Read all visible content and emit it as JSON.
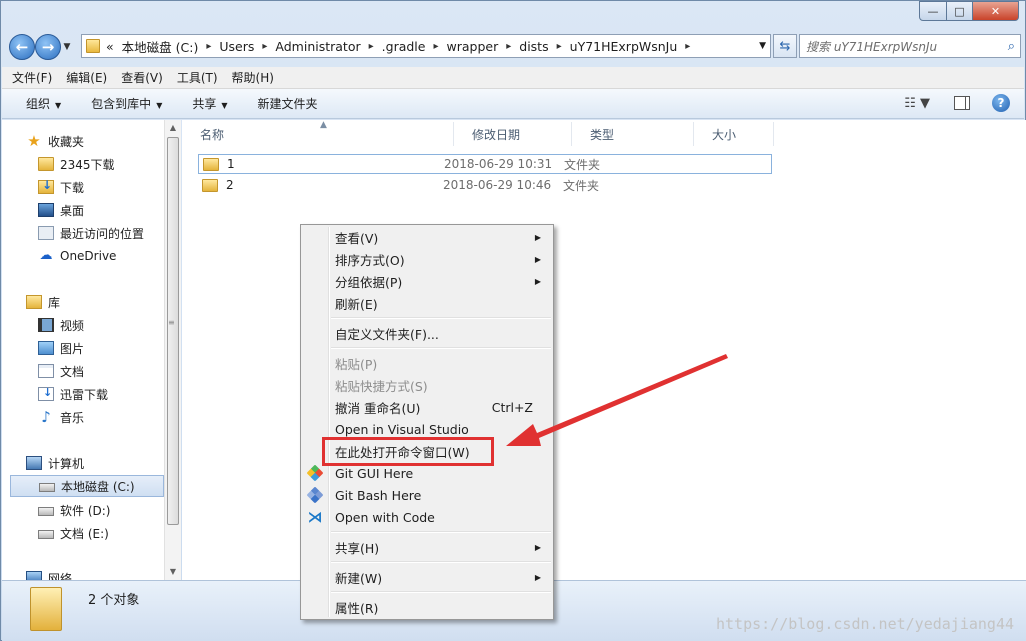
{
  "window": {
    "caption_buttons": {
      "minimize": "—",
      "maximize": "□",
      "close": "✕"
    }
  },
  "nav": {
    "back_icon": "arrow-left-icon",
    "forward_icon": "arrow-right-icon",
    "breadcrumb_prefix": "«",
    "breadcrumb": [
      "本地磁盘 (C:)",
      "Users",
      "Administrator",
      ".gradle",
      "wrapper",
      "dists",
      "uY71HExrpWsnJu"
    ],
    "search_placeholder": "搜索 uY71HExrpWsnJu"
  },
  "menubar": [
    "文件(F)",
    "编辑(E)",
    "查看(V)",
    "工具(T)",
    "帮助(H)"
  ],
  "commandbar": {
    "organize": "组织",
    "include_in_library": "包含到库中",
    "share": "共享",
    "new_folder": "新建文件夹"
  },
  "sidebar": {
    "favorites": {
      "label": "收藏夹",
      "items": [
        "2345下载",
        "下载",
        "桌面",
        "最近访问的位置",
        "OneDrive"
      ]
    },
    "libraries": {
      "label": "库",
      "items": [
        "视频",
        "图片",
        "文档",
        "迅雷下载",
        "音乐"
      ]
    },
    "computer": {
      "label": "计算机",
      "items": [
        "本地磁盘 (C:)",
        "软件 (D:)",
        "文档 (E:)"
      ]
    },
    "network": {
      "label": "网络"
    }
  },
  "columns": {
    "name": "名称",
    "modified": "修改日期",
    "type": "类型",
    "size": "大小"
  },
  "files": [
    {
      "name": "1",
      "modified": "2018-06-29 10:31",
      "type": "文件夹"
    },
    {
      "name": "2",
      "modified": "2018-06-29 10:46",
      "type": "文件夹"
    }
  ],
  "status": {
    "count_text": "2 个对象"
  },
  "watermark": "https://blog.csdn.net/yedajiang44",
  "context_menu": {
    "view": "查看(V)",
    "sort_by": "排序方式(O)",
    "group_by": "分组依据(P)",
    "refresh": "刷新(E)",
    "customize": "自定义文件夹(F)...",
    "paste": "粘贴(P)",
    "paste_shortcut": "粘贴快捷方式(S)",
    "undo": "撤消 重命名(U)",
    "undo_shortcut": "Ctrl+Z",
    "open_vs": "Open in Visual Studio",
    "open_cmd": "在此处打开命令窗口(W)",
    "git_gui": "Git GUI Here",
    "git_bash": "Git Bash Here",
    "open_code": "Open with Code",
    "share": "共享(H)",
    "new": "新建(W)",
    "properties": "属性(R)"
  },
  "annotation": {
    "color": "#e03131"
  }
}
